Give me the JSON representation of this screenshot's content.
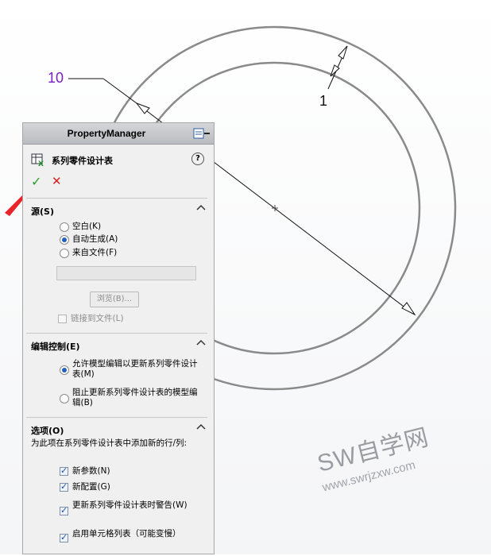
{
  "drawing": {
    "dimension_diameter": "10",
    "dimension_thickness": "1",
    "colors": {
      "circle": "#8a8a8a",
      "dim_line": "#111111",
      "dim_text_purple": "#7a1fc0",
      "arrow_red": "#e8232a"
    }
  },
  "property_manager": {
    "header_title": "PropertyManager",
    "feature_title": "系列零件设计表",
    "help_label": "?",
    "ok_icon": "✓",
    "cancel_icon": "✕",
    "source_group": {
      "title": "源(S)",
      "options": [
        {
          "label": "空白(K)",
          "selected": false
        },
        {
          "label": "自动生成(A)",
          "selected": true
        },
        {
          "label": "来自文件(F)",
          "selected": false
        }
      ],
      "file_path_value": "",
      "browse_label": "浏览(B)...",
      "link_to_file_label": "链接到文件(L)",
      "link_to_file_checked": false
    },
    "edit_control_group": {
      "title": "编辑控制(E)",
      "options": [
        {
          "label": "允许模型编辑以更新系列零件设计表(M)",
          "selected": true
        },
        {
          "label": "阻止更新系列零件设计表的模型编辑(B)",
          "selected": false
        }
      ]
    },
    "options_group": {
      "title": "选项(O)",
      "description": "为此项在系列零件设计表中添加新的行/列:",
      "checks": [
        {
          "label": "新参数(N)",
          "checked": true
        },
        {
          "label": "新配置(G)",
          "checked": true
        },
        {
          "label": "更新系列零件设计表时警告(W)",
          "checked": true
        },
        {
          "label": "启用单元格列表（可能变慢）",
          "checked": true
        }
      ]
    }
  },
  "watermark": {
    "brand": "SW自学网",
    "url": "www.swrjzxw.com"
  }
}
